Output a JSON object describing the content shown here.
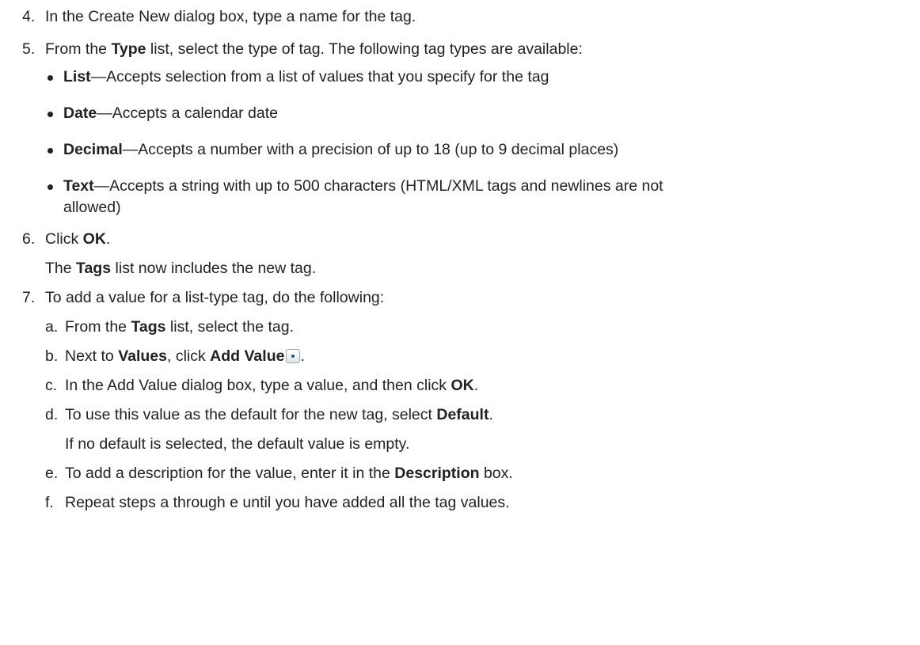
{
  "steps": {
    "s4": {
      "num": "4.",
      "text": "In the Create New dialog box, type a name for the tag."
    },
    "s5": {
      "num": "5.",
      "pre": "From the ",
      "bold": "Type",
      "post": " list, select the type of tag. The following tag types are available:"
    },
    "types": [
      {
        "name": "List",
        "desc": "—Accepts selection from a list of values that you specify for the tag"
      },
      {
        "name": "Date",
        "desc": "—Accepts a calendar date"
      },
      {
        "name": "Decimal",
        "desc": "—Accepts a number with a precision of up to 18 (up to 9 decimal places)"
      },
      {
        "name": "Text",
        "desc": "—Accepts a string with up to 500 characters (HTML/XML tags and newlines are not",
        "desc_cont": "allowed)"
      }
    ],
    "s6": {
      "num": "6.",
      "pre": "Click ",
      "bold": "OK",
      "post": ".",
      "note_pre": "The ",
      "note_bold": "Tags",
      "note_post": " list now includes the new tag."
    },
    "s7": {
      "num": "7.",
      "text": "To add a value for a list-type tag, do the following:"
    },
    "sub": {
      "a": {
        "letter": "a.",
        "pre": "From the ",
        "bold": "Tags",
        "post": " list, select the tag."
      },
      "b": {
        "letter": "b.",
        "pre": "Next to ",
        "bold1": "Values",
        "mid": ", click ",
        "bold2": "Add Value",
        "post": ".",
        "icon": "add-value-icon"
      },
      "c": {
        "letter": "c.",
        "pre": "In the Add Value dialog box, type a value, and then click ",
        "bold": "OK",
        "post": "."
      },
      "d": {
        "letter": "d.",
        "pre": "To use this value as the default for the new tag, select ",
        "bold": "Default",
        "post": ".",
        "note": "If no default is selected, the default value is empty."
      },
      "e": {
        "letter": "e.",
        "pre": "To add a description for the value, enter it in the ",
        "bold": "Description",
        "post": " box."
      },
      "f": {
        "letter": "f.",
        "text": "Repeat steps a through e until you have added all the tag values."
      }
    }
  }
}
